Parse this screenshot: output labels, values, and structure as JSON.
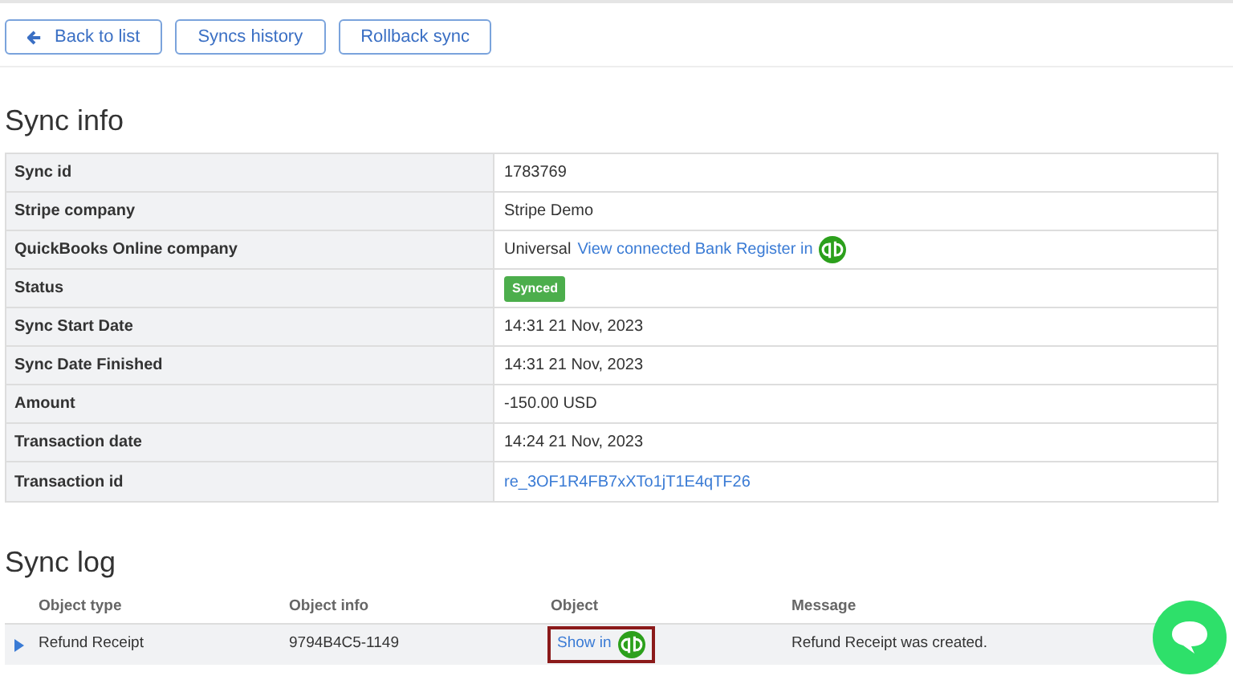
{
  "toolbar": {
    "buttons": [
      {
        "label": "Back to list",
        "kind": "back"
      },
      {
        "label": "Syncs history",
        "kind": "plain"
      },
      {
        "label": "Rollback sync",
        "kind": "plain"
      }
    ]
  },
  "sync_info": {
    "title": "Sync info",
    "rows": [
      {
        "label": "Sync id",
        "kind": "text",
        "value": "1783769"
      },
      {
        "label": "Stripe company",
        "kind": "text",
        "value": "Stripe Demo"
      },
      {
        "label": "QuickBooks Online company",
        "kind": "text_link_logo",
        "value": "Universal",
        "link": "View connected Bank Register in"
      },
      {
        "label": "Status",
        "kind": "badge",
        "value": "Synced"
      },
      {
        "label": "Sync Start Date",
        "kind": "text",
        "value": "14:31 21 Nov, 2023"
      },
      {
        "label": "Sync Date Finished",
        "kind": "text",
        "value": "14:31 21 Nov, 2023"
      },
      {
        "label": "Amount",
        "kind": "text",
        "value": "-150.00 USD"
      },
      {
        "label": "Transaction date",
        "kind": "text",
        "value": "14:24 21 Nov, 2023"
      },
      {
        "label": "Transaction id",
        "kind": "link",
        "value": "re_3OF1R4FB7xXTo1jT1E4qTF26"
      }
    ]
  },
  "sync_log": {
    "title": "Sync log",
    "columns": [
      "Object type",
      "Object info",
      "Object",
      "Message"
    ],
    "rows": [
      {
        "expanded": false,
        "object_type": "Refund Receipt",
        "object_info": "9794B4C5-1149",
        "object_link": "Show in",
        "highlighted": true,
        "message": "Refund Receipt was created."
      }
    ]
  }
}
